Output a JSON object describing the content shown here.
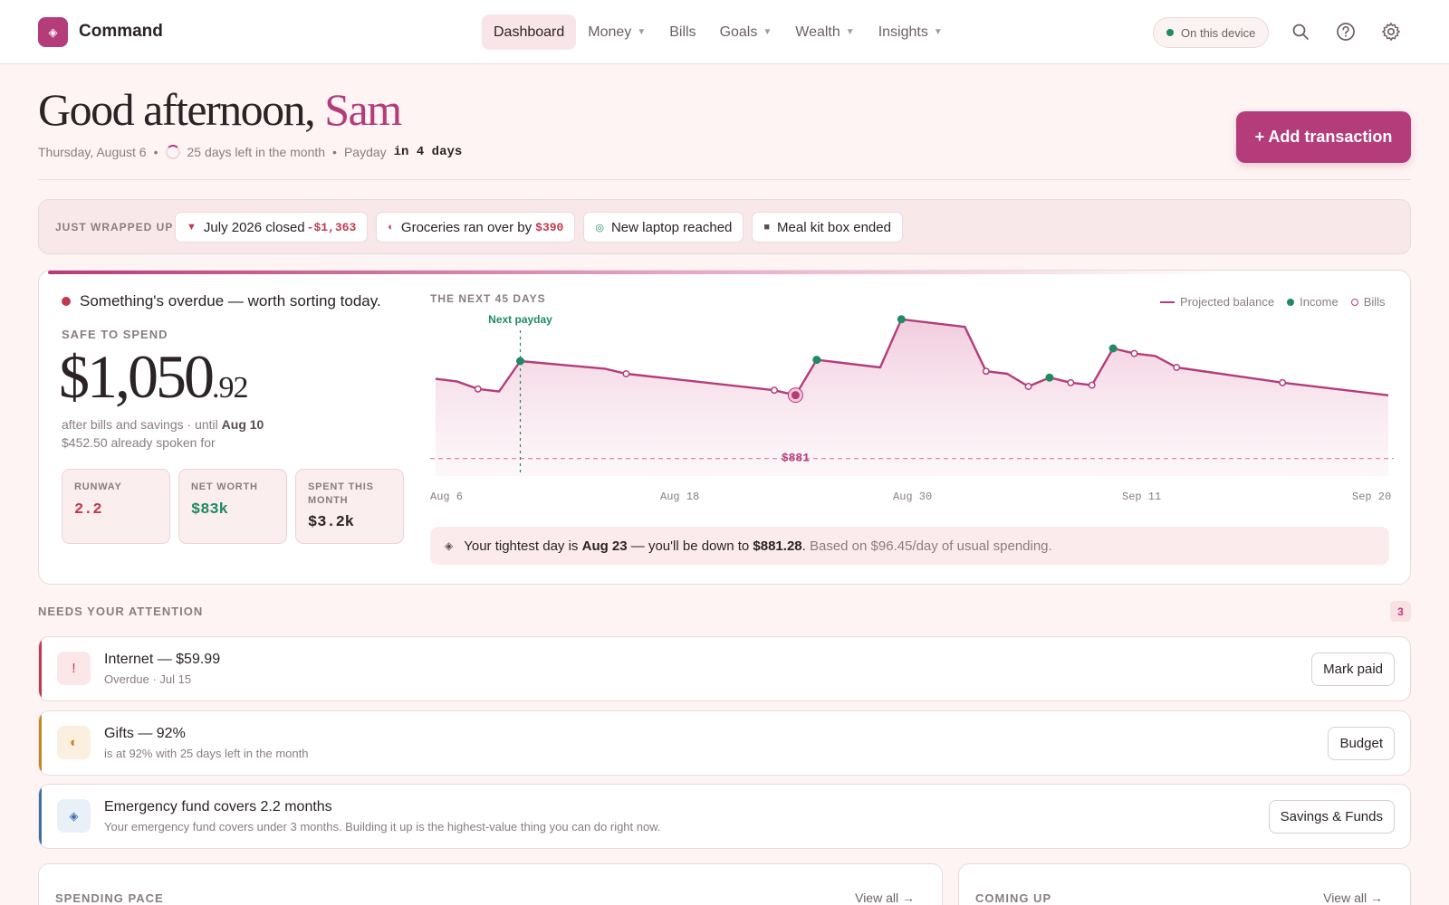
{
  "app": {
    "name": "Command",
    "logo_glyph": "◈"
  },
  "nav": {
    "items": [
      {
        "label": "Dashboard",
        "active": true,
        "has_menu": false
      },
      {
        "label": "Money",
        "active": false,
        "has_menu": true
      },
      {
        "label": "Bills",
        "active": false,
        "has_menu": false
      },
      {
        "label": "Goals",
        "active": false,
        "has_menu": true
      },
      {
        "label": "Wealth",
        "active": false,
        "has_menu": true
      },
      {
        "label": "Insights",
        "active": false,
        "has_menu": true
      }
    ],
    "device_pill": "On this device",
    "icons": [
      "search-icon",
      "help-icon",
      "gear-icon"
    ]
  },
  "header": {
    "greeting": "Good afternoon,",
    "name": "Sam",
    "date": "Thursday, August 6",
    "days_left": "25 days left in the month",
    "payday_label": "Payday",
    "payday_value": "in 4 days",
    "add_button": "+ Add transaction"
  },
  "wrapped": {
    "label": "JUST WRAPPED UP",
    "chips": [
      {
        "icon": "▼",
        "icon_color": "#c0394f",
        "text": "July 2026 closed",
        "value": "-$1,363"
      },
      {
        "icon": "◐",
        "icon_color": "#c0394f",
        "text": "Groceries ran over by",
        "value": "$390"
      },
      {
        "icon": "◎",
        "icon_color": "#1f8a63",
        "text": "New laptop reached",
        "value": ""
      },
      {
        "icon": "■",
        "icon_color": "#5a4d52",
        "text": "Meal kit box ended",
        "value": ""
      }
    ]
  },
  "hero": {
    "overdue_text": "Something's overdue — worth sorting today.",
    "safe_label": "SAFE TO SPEND",
    "amount_main": "$1,050",
    "amount_cents": ".92",
    "after_text": "after bills and savings · until",
    "after_date": "Aug 10",
    "spoken_text": "$452.50 already spoken for",
    "stats": [
      {
        "label": "RUNWAY",
        "value": "2.2",
        "color": "#c0394f"
      },
      {
        "label": "NET WORTH",
        "value": "$83k",
        "color": "#1f8a63"
      },
      {
        "label": "SPENT THIS MONTH",
        "value": "$3.2k",
        "color": "#2b2326"
      }
    ],
    "tight_text_1": "Your tightest day is",
    "tight_date": "Aug 23",
    "tight_text_2": "— you'll be down to",
    "tight_amount": "$881.28",
    "tight_text_3": "Based on $96.45/day of usual spending."
  },
  "chart_data": {
    "type": "area",
    "title": "THE NEXT 45 DAYS",
    "legend": [
      "Projected balance",
      "Income",
      "Bills"
    ],
    "legend_position": "top-right",
    "x_ticks": [
      "Aug 6",
      "Aug 18",
      "Aug 30",
      "Sep 11",
      "Sep 20"
    ],
    "x_domain": [
      0,
      45
    ],
    "y_range": [
      800,
      2050
    ],
    "annotation_payday": {
      "label": "Next payday",
      "day": 4
    },
    "floor_label": "$881",
    "floor_value": 881,
    "min_point": {
      "day": 17,
      "value": 881
    },
    "series": [
      {
        "name": "Projected balance",
        "points": [
          [
            0,
            1510
          ],
          [
            1,
            1490
          ],
          [
            2,
            1430
          ],
          [
            3,
            1410
          ],
          [
            4,
            1650
          ],
          [
            8,
            1590
          ],
          [
            9,
            1550
          ],
          [
            16,
            1420
          ],
          [
            17,
            1381
          ],
          [
            18,
            1660
          ],
          [
            21,
            1600
          ],
          [
            22,
            1980
          ],
          [
            25,
            1920
          ],
          [
            26,
            1570
          ],
          [
            27,
            1550
          ],
          [
            28,
            1450
          ],
          [
            29,
            1520
          ],
          [
            30,
            1480
          ],
          [
            31,
            1460
          ],
          [
            32,
            1750
          ],
          [
            33,
            1710
          ],
          [
            34,
            1690
          ],
          [
            35,
            1600
          ],
          [
            40,
            1480
          ],
          [
            45,
            1380
          ]
        ]
      }
    ],
    "income_points": [
      [
        4,
        1650
      ],
      [
        18,
        1660
      ],
      [
        22,
        1980
      ],
      [
        29,
        1520
      ],
      [
        32,
        1750
      ]
    ],
    "bill_points": [
      [
        2,
        1430
      ],
      [
        9,
        1550
      ],
      [
        16,
        1420
      ],
      [
        26,
        1570
      ],
      [
        28,
        1450
      ],
      [
        30,
        1480
      ],
      [
        31,
        1460
      ],
      [
        33,
        1710
      ],
      [
        35,
        1600
      ],
      [
        40,
        1480
      ]
    ],
    "colors": {
      "balance": "#b43c7a",
      "income": "#1f8a63",
      "bills": "#b43c7a"
    }
  },
  "attention": {
    "label": "NEEDS YOUR ATTENTION",
    "count": "3",
    "items": [
      {
        "icon": "!",
        "color": "#c0394f",
        "bg": "#fbe6e8",
        "title": "Internet — $59.99",
        "sub": "Overdue · Jul 15",
        "button": "Mark paid"
      },
      {
        "icon": "◐",
        "color": "#c58420",
        "bg": "#fbf0df",
        "title": "Gifts — 92%",
        "sub": "is at 92% with 25 days left in the month",
        "button": "Budget"
      },
      {
        "icon": "◈",
        "color": "#3b6fa8",
        "bg": "#e9f0f8",
        "title": "Emergency fund covers 2.2 months",
        "sub": "Your emergency fund covers under 3 months. Building it up is the highest-value thing you can do right now.",
        "button": "Savings & Funds"
      }
    ]
  },
  "bottom": {
    "spending_label": "SPENDING PACE",
    "spending_link": "View all →",
    "coming_label": "COMING UP",
    "coming_link": "View all →"
  }
}
